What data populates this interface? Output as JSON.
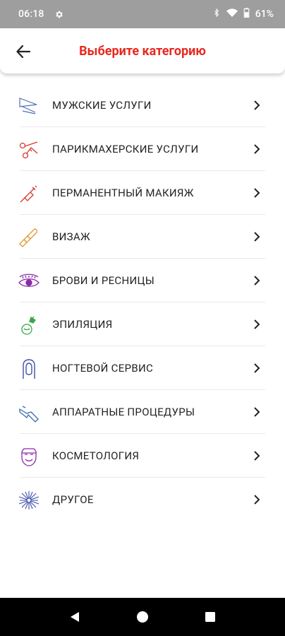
{
  "status": {
    "time": "06:18",
    "battery": "61%"
  },
  "header": {
    "title": "Выберите категорию"
  },
  "categories": [
    {
      "label": "Мужские услуги",
      "icon": "razor-icon"
    },
    {
      "label": "Парикмахерские услуги",
      "icon": "scissors-icon"
    },
    {
      "label": "Перманентный макияж",
      "icon": "tattoo-pen-icon"
    },
    {
      "label": "Визаж",
      "icon": "makeup-brush-icon"
    },
    {
      "label": "Брови и ресницы",
      "icon": "eye-icon"
    },
    {
      "label": "Эпиляция",
      "icon": "wax-jar-icon"
    },
    {
      "label": "Ногтевой сервис",
      "icon": "nail-icon"
    },
    {
      "label": "Аппаратные процедуры",
      "icon": "device-icon"
    },
    {
      "label": "Косметология",
      "icon": "face-mask-icon"
    },
    {
      "label": "Другое",
      "icon": "sparkle-icon"
    }
  ],
  "colors": {
    "accent": "#e8291f",
    "status_bar": "#9e9e9e",
    "nav_bar": "#000000"
  }
}
